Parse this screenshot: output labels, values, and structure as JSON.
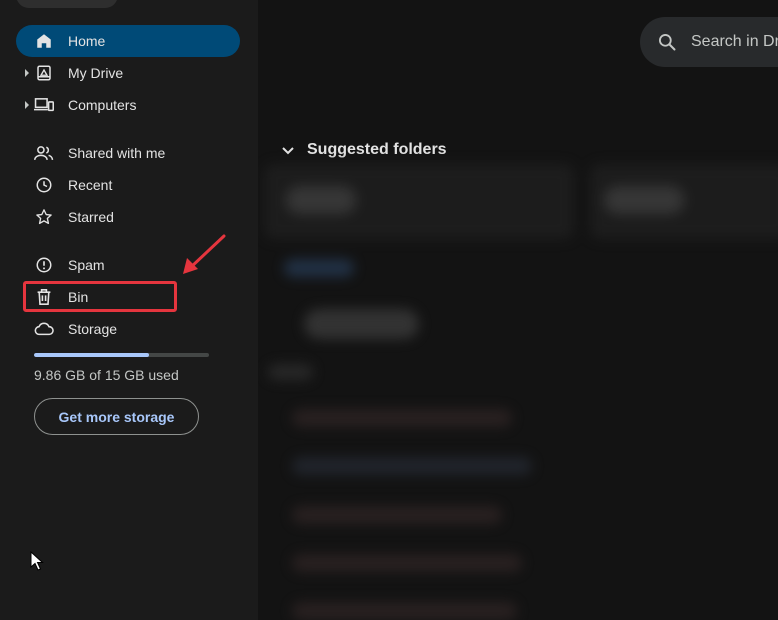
{
  "sidebar": {
    "items": [
      {
        "label": "Home",
        "icon": "home-icon",
        "active": true,
        "caret": false
      },
      {
        "label": "My Drive",
        "icon": "my-drive-icon",
        "active": false,
        "caret": true
      },
      {
        "label": "Computers",
        "icon": "computers-icon",
        "active": false,
        "caret": true
      },
      {
        "label": "Shared with me",
        "icon": "shared-with-me-icon",
        "active": false,
        "caret": false
      },
      {
        "label": "Recent",
        "icon": "recent-clock-icon",
        "active": false,
        "caret": false
      },
      {
        "label": "Starred",
        "icon": "star-icon",
        "active": false,
        "caret": false
      },
      {
        "label": "Spam",
        "icon": "spam-icon",
        "active": false,
        "caret": false
      },
      {
        "label": "Bin",
        "icon": "trash-icon",
        "active": false,
        "caret": false
      },
      {
        "label": "Storage",
        "icon": "cloud-icon",
        "active": false,
        "caret": false
      }
    ],
    "storage": {
      "used_text": "9.86 GB of 15 GB used",
      "used_fraction": 0.657,
      "cta_label": "Get more storage"
    }
  },
  "main": {
    "search_placeholder": "Search in Dri",
    "section_title": "Suggested folders"
  },
  "colors": {
    "active_nav_bg": "#004a77",
    "storage_fill": "#a8c7fa",
    "annotation_red": "#e5353e"
  }
}
